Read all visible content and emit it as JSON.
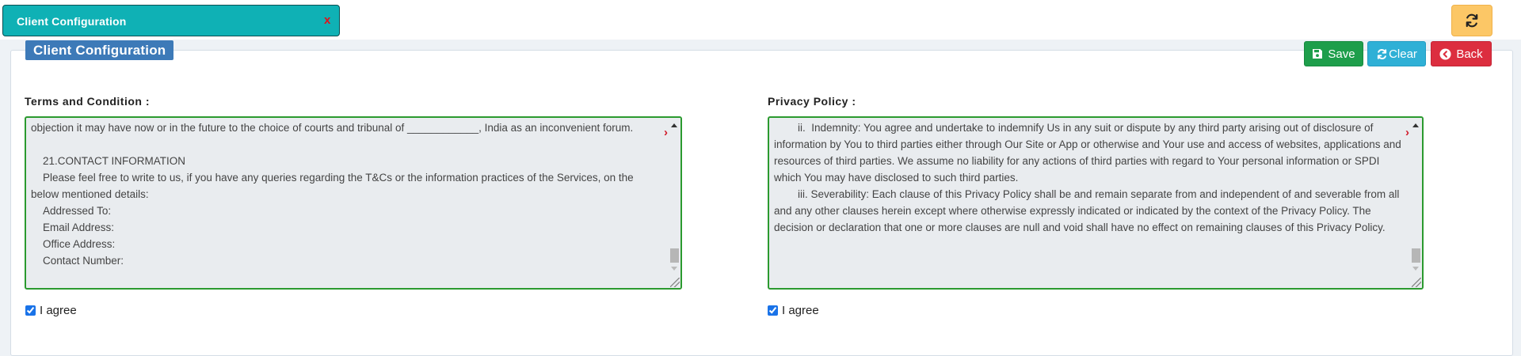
{
  "tab": {
    "title": "Client Configuration",
    "close": "x"
  },
  "panel": {
    "title": "Client Configuration"
  },
  "toolbar": {
    "save_label": "Save",
    "clear_label": "Clear",
    "back_label": "Back"
  },
  "terms": {
    "label": "Terms and Condition :",
    "text": "objection it may have now or in the future to the choice of courts and tribunal of ____________, India as an inconvenient forum.\n\n    21.CONTACT INFORMATION\n    Please feel free to write to us, if you have any queries regarding the T&Cs or the information practices of the Services, on the below mentioned details:\n    Addressed To:\n    Email Address:\n    Office Address:\n    Contact Number:",
    "agree_label": "I agree",
    "agree_checked": true
  },
  "privacy": {
    "label": "Privacy Policy :",
    "text": "        ii.  Indemnity: You agree and undertake to indemnify Us in any suit or dispute by any third party arising out of disclosure of information by You to third parties either through Our Site or App or otherwise and Your use and access of websites, applications and resources of third parties. We assume no liability for any actions of third parties with regard to Your personal information or SPDI which You may have disclosed to such third parties.\n        iii. Severability: Each clause of this Privacy Policy shall be and remain separate from and independent of and severable from all and any other clauses herein except where otherwise expressly indicated or indicated by the context of the Privacy Policy. The decision or declaration that one or more clauses are null and void shall have no effect on remaining clauses of this Privacy Policy.",
    "agree_label": "I agree",
    "agree_checked": true
  },
  "colors": {
    "tab": "#0fb1b5",
    "refresh": "#fcc766",
    "legend": "#3d7ab8",
    "save": "#1e9e4b",
    "clear": "#2fb0d6",
    "back": "#dc2e3f",
    "textbox_border": "#2b9a2f"
  },
  "icons": {
    "refresh": "refresh-icon",
    "save": "floppy-disk-icon",
    "clear": "refresh-icon",
    "back": "circle-arrow-left-icon"
  }
}
